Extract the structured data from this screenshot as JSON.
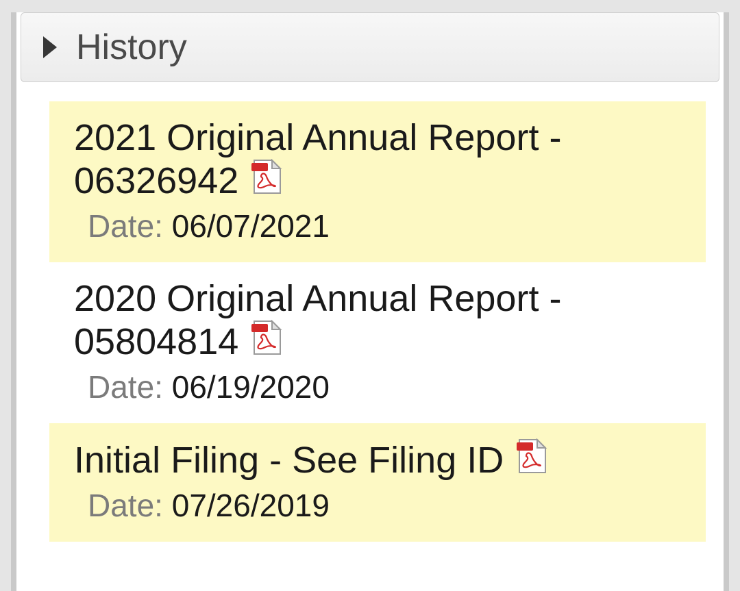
{
  "header": {
    "title": "History"
  },
  "date_label": "Date:",
  "items": [
    {
      "title": "2021 Original Annual Report - 06326942",
      "date": "06/07/2021"
    },
    {
      "title": "2020 Original Annual Report - 05804814",
      "date": "06/19/2020"
    },
    {
      "title": "Initial Filing - See Filing ID",
      "date": "07/26/2019"
    }
  ]
}
